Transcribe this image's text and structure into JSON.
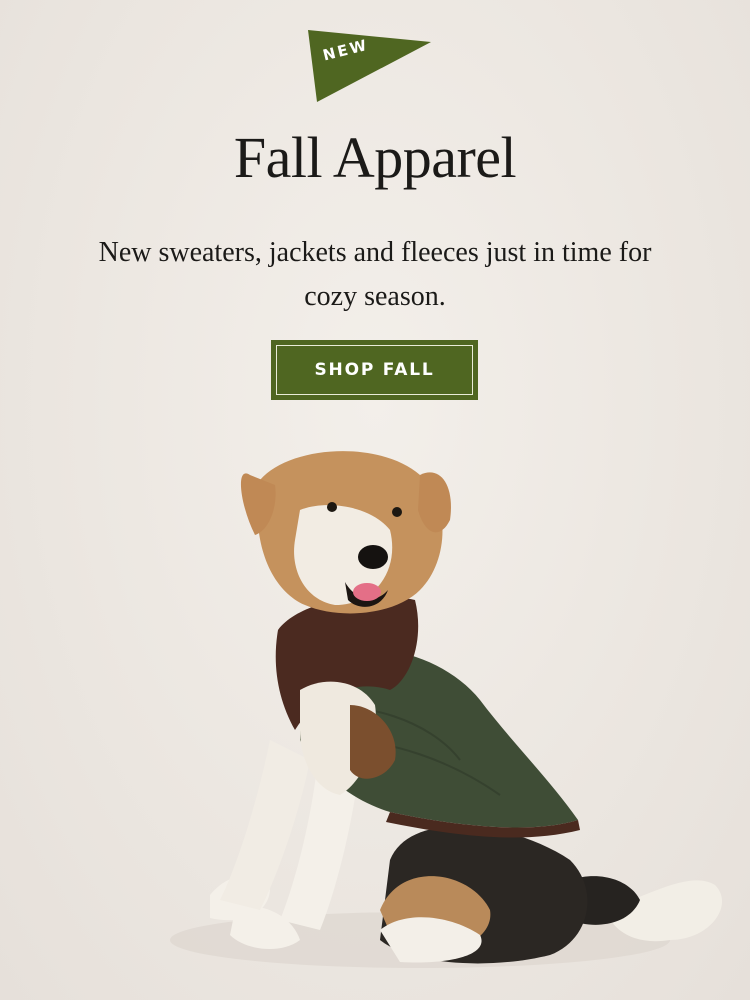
{
  "badge": {
    "label": "NEW",
    "color": "#4f6621"
  },
  "hero": {
    "title": "Fall Apparel",
    "subtitle": "New sweaters, jackets and fleeces just in time for cozy season."
  },
  "cta": {
    "label": "SHOP FALL",
    "color": "#4f6621"
  },
  "image": {
    "subject": "dog wearing a green quilted jacket with brown collar"
  }
}
